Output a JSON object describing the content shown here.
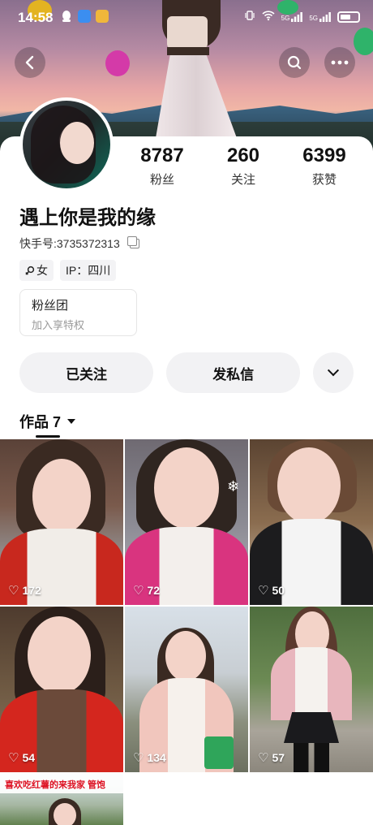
{
  "status_bar": {
    "time": "14:58",
    "network_1": "5G",
    "network_2": "5G"
  },
  "profile": {
    "name": "遇上你是我的缘",
    "kuaishou_label": "快手号:",
    "kuaishou_id": "3735372313",
    "stats": [
      {
        "value": "8787",
        "label": "粉丝"
      },
      {
        "value": "260",
        "label": "关注"
      },
      {
        "value": "6399",
        "label": "获赞"
      }
    ],
    "tags": {
      "gender": "女",
      "ip": "IP：四川"
    }
  },
  "fan_club": {
    "title": "粉丝团",
    "subtitle": "加入享特权"
  },
  "actions": {
    "follow": "已关注",
    "message": "发私信"
  },
  "works_tab": {
    "label": "作品 7"
  },
  "works": [
    {
      "likes": "172"
    },
    {
      "likes": "72"
    },
    {
      "likes": "50"
    },
    {
      "likes": "54"
    },
    {
      "likes": "134"
    },
    {
      "likes": "57"
    },
    {
      "banner": "喜欢吃红薯的来我家 管饱"
    }
  ],
  "colors": {
    "button_bg": "#f2f2f4",
    "text_primary": "#111111",
    "text_secondary": "#999999"
  }
}
